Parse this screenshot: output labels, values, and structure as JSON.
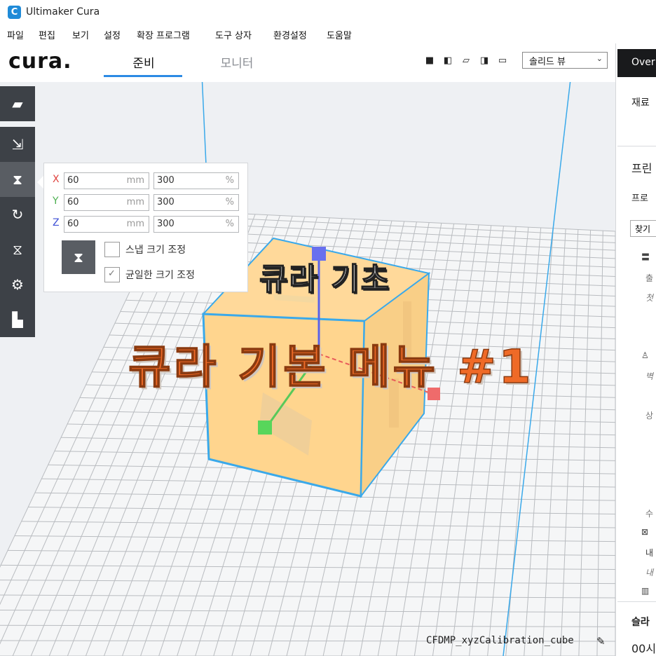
{
  "window": {
    "title": "Ultimaker Cura"
  },
  "menu": [
    "파일",
    "편집",
    "보기",
    "설정",
    "확장 프로그램",
    "도구 상자",
    "환경설정",
    "도움말"
  ],
  "header": {
    "logo": "cura.",
    "tabs": [
      {
        "label": "준비",
        "active": true
      },
      {
        "label": "모니터",
        "active": false
      }
    ],
    "view_mode": "솔리드 뷰",
    "view_icons": [
      "3d-view-icon",
      "front-view-icon",
      "top-view-icon",
      "left-view-icon",
      "right-view-icon"
    ]
  },
  "right_panel": {
    "overview_label": "Over",
    "material_label": "재료",
    "section1": "프린",
    "profile_label": "프로",
    "search_placeholder": "찾기",
    "rows": [
      "출",
      "첫",
      "벽",
      "상",
      "수",
      "내",
      "내"
    ],
    "bottom_label": "슬라",
    "bottom_value": "00시"
  },
  "toolbar": {
    "tools": [
      {
        "name": "open-file-icon"
      },
      {
        "name": "move-tool-icon"
      },
      {
        "name": "scale-tool-icon",
        "selected": true
      },
      {
        "name": "rotate-tool-icon"
      },
      {
        "name": "mirror-tool-icon"
      },
      {
        "name": "per-model-settings-icon"
      },
      {
        "name": "support-blocker-icon"
      }
    ]
  },
  "scale_panel": {
    "rows": [
      {
        "axis": "X",
        "color": "#e0433f",
        "mm": "60",
        "unit_mm": "mm",
        "pct": "300",
        "unit_pct": "%"
      },
      {
        "axis": "Y",
        "color": "#4caf50",
        "mm": "60",
        "unit_mm": "mm",
        "pct": "300",
        "unit_pct": "%"
      },
      {
        "axis": "Z",
        "color": "#3f51d6",
        "mm": "60",
        "unit_mm": "mm",
        "pct": "300",
        "unit_pct": "%"
      }
    ],
    "snap_label": "스냅 크기 조정",
    "snap_checked": false,
    "uniform_label": "균일한 크기 조정",
    "uniform_checked": true
  },
  "overlay": {
    "subtitle": "큐라 기초",
    "title": "큐라 기본 메뉴 #1"
  },
  "model": {
    "filename": "CFDMP_xyzCalibration_cube"
  }
}
